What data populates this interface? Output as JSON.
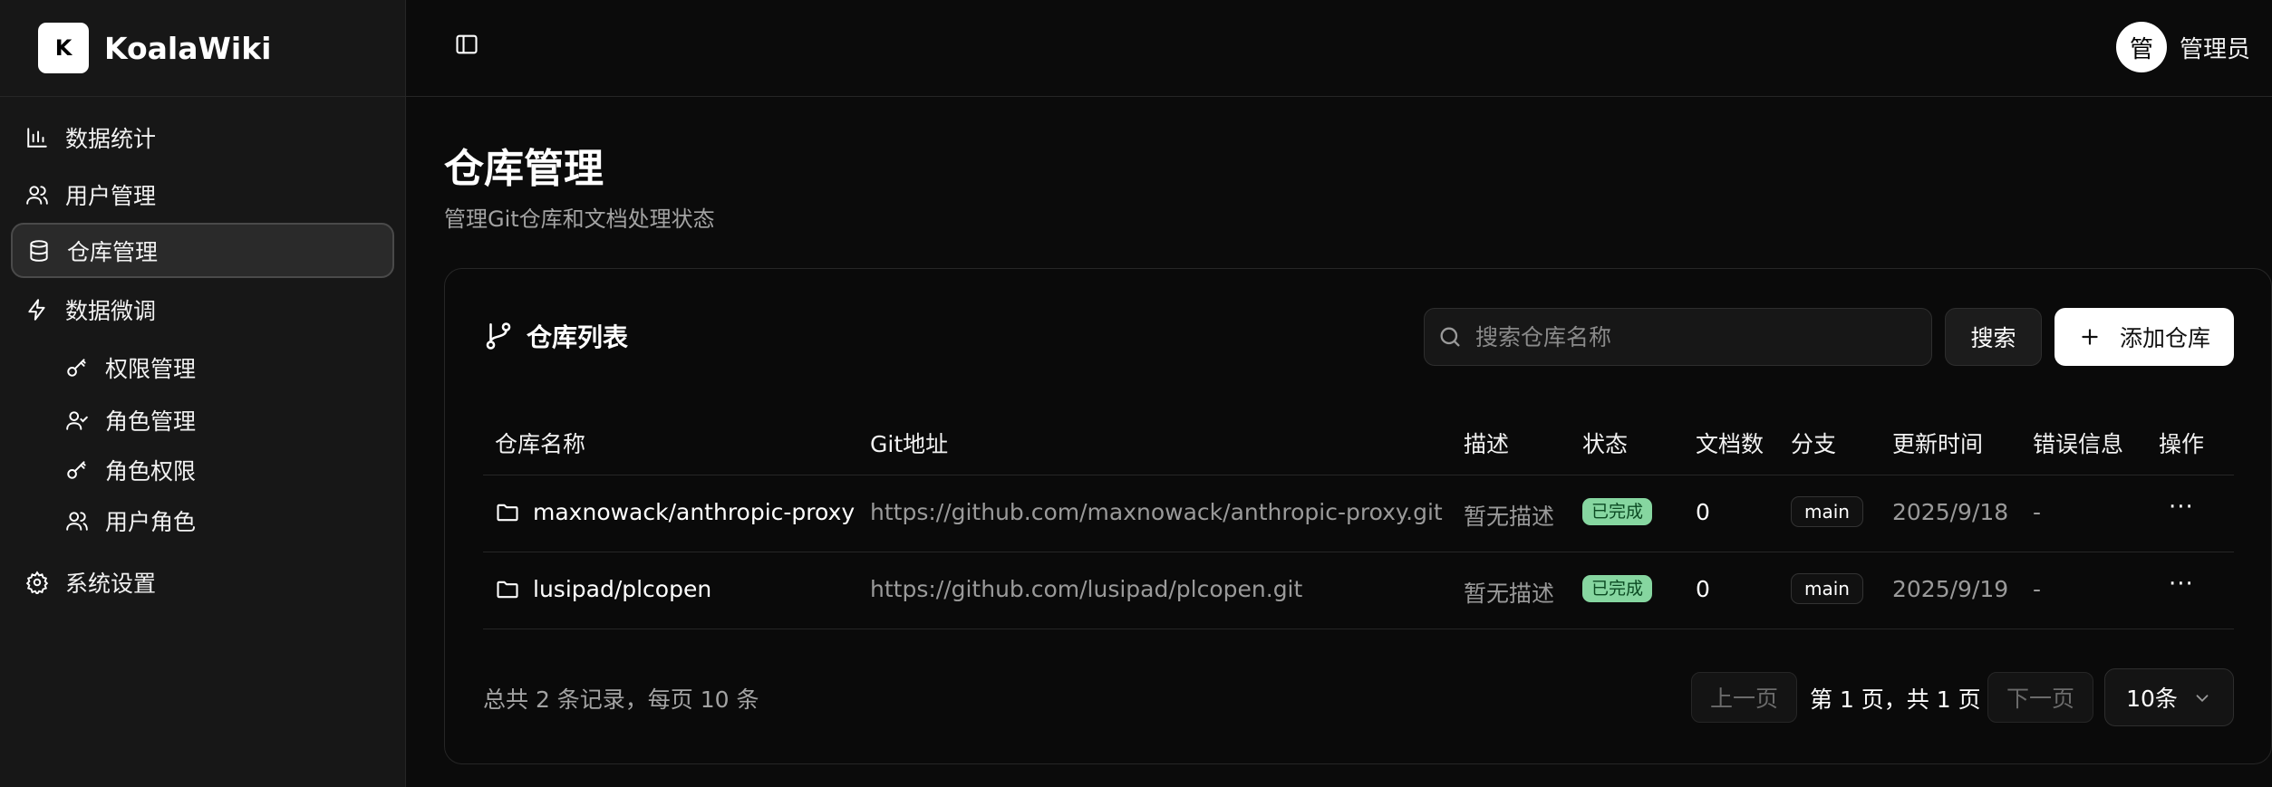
{
  "app": {
    "logo_letter": "K",
    "name": "KoalaWiki"
  },
  "sidebar": {
    "items": [
      {
        "label": "数据统计",
        "icon": "bar-chart-icon"
      },
      {
        "label": "用户管理",
        "icon": "users-icon"
      },
      {
        "label": "仓库管理",
        "icon": "database-icon",
        "active": true
      },
      {
        "label": "数据微调",
        "icon": "zap-icon"
      },
      {
        "label": "权限管理",
        "icon": "key-icon"
      },
      {
        "label": "角色管理",
        "icon": "user-check-icon"
      },
      {
        "label": "角色权限",
        "icon": "key-icon"
      },
      {
        "label": "用户角色",
        "icon": "users-icon"
      },
      {
        "label": "系统设置",
        "icon": "gear-icon"
      }
    ]
  },
  "header": {
    "avatar_char": "管",
    "username": "管理员"
  },
  "page": {
    "title": "仓库管理",
    "subtitle": "管理Git仓库和文档处理状态"
  },
  "card": {
    "title": "仓库列表",
    "search_placeholder": "搜索仓库名称",
    "search_button": "搜索",
    "add_button": "添加仓库"
  },
  "table": {
    "columns": [
      "仓库名称",
      "Git地址",
      "描述",
      "状态",
      "文档数",
      "分支",
      "更新时间",
      "错误信息",
      "操作"
    ],
    "rows": [
      {
        "name": "maxnowack/anthropic-proxy",
        "git": "https://github.com/maxnowack/anthropic-proxy.git",
        "desc": "暂无描述",
        "status": "已完成",
        "docs": "0",
        "branch": "main",
        "updated": "2025/9/18",
        "error": "-",
        "action": "···"
      },
      {
        "name": "lusipad/plcopen",
        "git": "https://github.com/lusipad/plcopen.git",
        "desc": "暂无描述",
        "status": "已完成",
        "docs": "0",
        "branch": "main",
        "updated": "2025/9/19",
        "error": "-",
        "action": "···"
      }
    ]
  },
  "pagination": {
    "summary": "总共 2 条记录，每页 10 条",
    "prev": "上一页",
    "info": "第 1 页，共 1 页",
    "next": "下一页",
    "page_size": "10条"
  },
  "colors": {
    "background": "#0b0b0b",
    "sidebar": "#171717",
    "status_done": "#86d6a0"
  }
}
